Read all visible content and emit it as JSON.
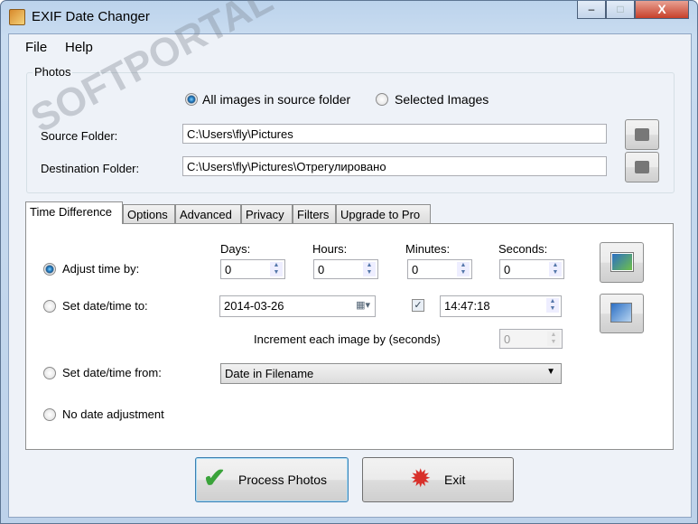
{
  "window": {
    "title": "EXIF Date Changer",
    "minimize": "–",
    "maximize": "□",
    "close": "X"
  },
  "menu": {
    "file": "File",
    "help": "Help"
  },
  "photos": {
    "group_label": "Photos",
    "option_all": "All images in source folder",
    "option_selected": "Selected Images",
    "selected_option": "all",
    "source_label": "Source Folder:",
    "source_value": "C:\\Users\\fly\\Pictures",
    "dest_label": "Destination Folder:",
    "dest_value": "C:\\Users\\fly\\Pictures\\Отрегулировано"
  },
  "tabs": [
    "Time Difference",
    "Options",
    "Advanced",
    "Privacy",
    "Filters",
    "Upgrade to Pro"
  ],
  "active_tab": "Time Difference",
  "time": {
    "days_label": "Days:",
    "hours_label": "Hours:",
    "minutes_label": "Minutes:",
    "seconds_label": "Seconds:",
    "days": "0",
    "hours": "0",
    "minutes": "0",
    "seconds": "0",
    "adjust_label": "Adjust time by:",
    "set_label": "Set date/time to:",
    "date": "2014-03-26",
    "time_value": "14:47:18",
    "time_checked": true,
    "increment_label": "Increment each image by (seconds)",
    "increment": "0",
    "from_label": "Set date/time from:",
    "from_value": "Date in Filename",
    "none_label": "No date adjustment",
    "selected_mode": "adjust"
  },
  "buttons": {
    "process": "Process Photos",
    "exit": "Exit"
  },
  "watermark": "SOFTPORTAL www.softportal.com"
}
